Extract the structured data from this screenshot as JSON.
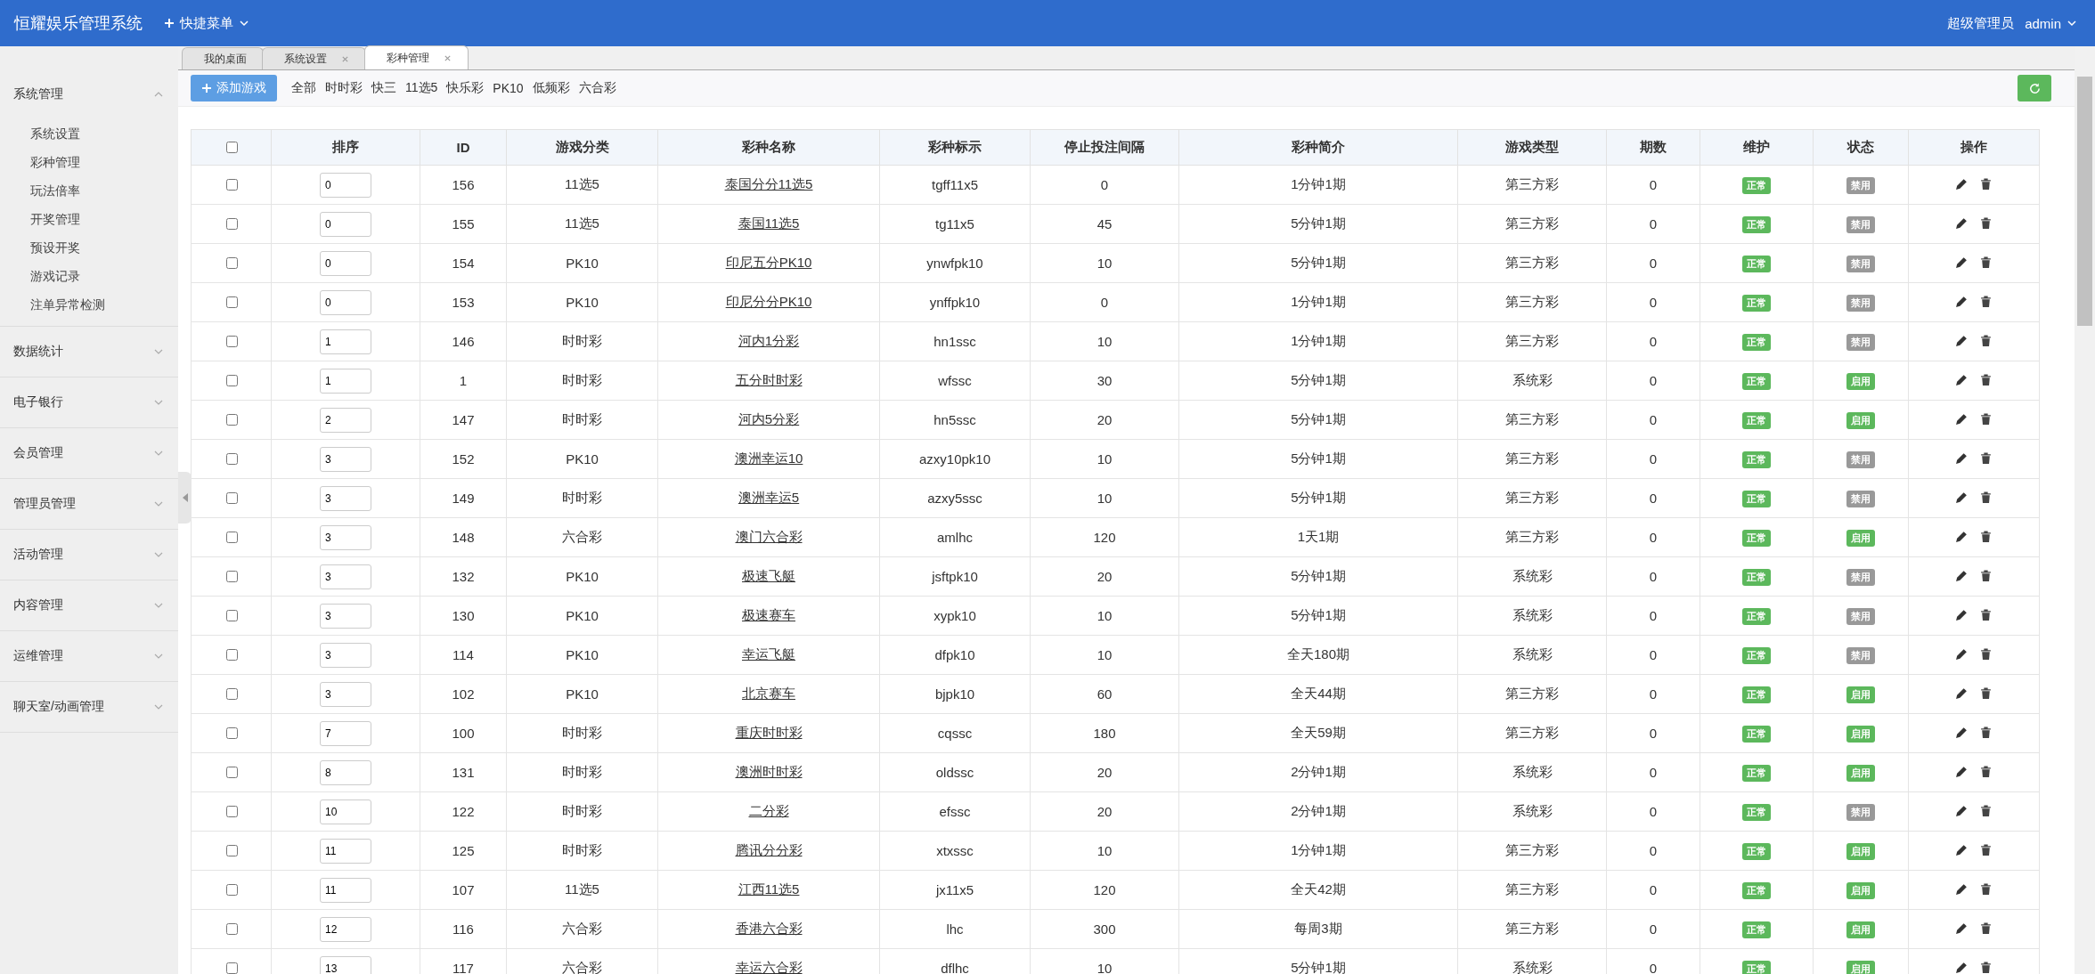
{
  "app": {
    "title": "恒耀娱乐管理系统",
    "quick_menu": "快捷菜单"
  },
  "user": {
    "role": "超级管理员",
    "name": "admin"
  },
  "sidebar": [
    {
      "label": "系统管理",
      "expanded": true,
      "children": [
        {
          "label": "系统设置"
        },
        {
          "label": "彩种管理"
        },
        {
          "label": "玩法倍率"
        },
        {
          "label": "开奖管理"
        },
        {
          "label": "预设开奖"
        },
        {
          "label": "游戏记录"
        },
        {
          "label": "注单异常检测"
        }
      ]
    },
    {
      "label": "数据统计",
      "expanded": false
    },
    {
      "label": "电子银行",
      "expanded": false
    },
    {
      "label": "会员管理",
      "expanded": false
    },
    {
      "label": "管理员管理",
      "expanded": false
    },
    {
      "label": "活动管理",
      "expanded": false
    },
    {
      "label": "内容管理",
      "expanded": false
    },
    {
      "label": "运维管理",
      "expanded": false
    },
    {
      "label": "聊天室/动画管理",
      "expanded": false
    }
  ],
  "tabs": [
    {
      "label": "我的桌面",
      "selected": false,
      "closable": false
    },
    {
      "label": "系统设置",
      "selected": false,
      "closable": true
    },
    {
      "label": "彩种管理",
      "selected": true,
      "closable": true
    }
  ],
  "toolbar": {
    "add_button": "添加游戏",
    "filters": [
      "全部",
      "时时彩",
      "快三",
      "11选5",
      "快乐彩",
      "PK10",
      "低频彩",
      "六合彩"
    ]
  },
  "table": {
    "all_checked": false,
    "columns": [
      "排序",
      "ID",
      "游戏分类",
      "彩种名称",
      "彩种标示",
      "停止投注间隔",
      "彩种简介",
      "游戏类型",
      "期数",
      "维护",
      "状态",
      "操作"
    ],
    "rows": [
      {
        "checked": false,
        "sort": "0",
        "id": "156",
        "category": "11选5",
        "name": "泰国分分11选5",
        "code": "tgff11x5",
        "stop_interval": "0",
        "intro": "1分钟1期",
        "type": "第三方彩",
        "periods": "0",
        "maintenance": "正常",
        "status": "禁用",
        "enabled": false
      },
      {
        "checked": false,
        "sort": "0",
        "id": "155",
        "category": "11选5",
        "name": "泰国11选5",
        "code": "tg11x5",
        "stop_interval": "45",
        "intro": "5分钟1期",
        "type": "第三方彩",
        "periods": "0",
        "maintenance": "正常",
        "status": "禁用",
        "enabled": false
      },
      {
        "checked": false,
        "sort": "0",
        "id": "154",
        "category": "PK10",
        "name": "印尼五分PK10",
        "code": "ynwfpk10",
        "stop_interval": "10",
        "intro": "5分钟1期",
        "type": "第三方彩",
        "periods": "0",
        "maintenance": "正常",
        "status": "禁用",
        "enabled": false
      },
      {
        "checked": false,
        "sort": "0",
        "id": "153",
        "category": "PK10",
        "name": "印尼分分PK10",
        "code": "ynffpk10",
        "stop_interval": "0",
        "intro": "1分钟1期",
        "type": "第三方彩",
        "periods": "0",
        "maintenance": "正常",
        "status": "禁用",
        "enabled": false
      },
      {
        "checked": false,
        "sort": "1",
        "id": "146",
        "category": "时时彩",
        "name": "河内1分彩",
        "code": "hn1ssc",
        "stop_interval": "10",
        "intro": "1分钟1期",
        "type": "第三方彩",
        "periods": "0",
        "maintenance": "正常",
        "status": "禁用",
        "enabled": false
      },
      {
        "checked": false,
        "sort": "1",
        "id": "1",
        "category": "时时彩",
        "name": "五分时时彩",
        "code": "wfssc",
        "stop_interval": "30",
        "intro": "5分钟1期",
        "type": "系统彩",
        "periods": "0",
        "maintenance": "正常",
        "status": "启用",
        "enabled": true
      },
      {
        "checked": false,
        "sort": "2",
        "id": "147",
        "category": "时时彩",
        "name": "河内5分彩",
        "code": "hn5ssc",
        "stop_interval": "20",
        "intro": "5分钟1期",
        "type": "第三方彩",
        "periods": "0",
        "maintenance": "正常",
        "status": "启用",
        "enabled": true
      },
      {
        "checked": false,
        "sort": "3",
        "id": "152",
        "category": "PK10",
        "name": "澳洲幸运10",
        "code": "azxy10pk10",
        "stop_interval": "10",
        "intro": "5分钟1期",
        "type": "第三方彩",
        "periods": "0",
        "maintenance": "正常",
        "status": "禁用",
        "enabled": false
      },
      {
        "checked": false,
        "sort": "3",
        "id": "149",
        "category": "时时彩",
        "name": "澳洲幸运5",
        "code": "azxy5ssc",
        "stop_interval": "10",
        "intro": "5分钟1期",
        "type": "第三方彩",
        "periods": "0",
        "maintenance": "正常",
        "status": "禁用",
        "enabled": false
      },
      {
        "checked": false,
        "sort": "3",
        "id": "148",
        "category": "六合彩",
        "name": "澳门六合彩",
        "code": "amlhc",
        "stop_interval": "120",
        "intro": "1天1期",
        "type": "第三方彩",
        "periods": "0",
        "maintenance": "正常",
        "status": "启用",
        "enabled": true
      },
      {
        "checked": false,
        "sort": "3",
        "id": "132",
        "category": "PK10",
        "name": "极速飞艇",
        "code": "jsftpk10",
        "stop_interval": "20",
        "intro": "5分钟1期",
        "type": "系统彩",
        "periods": "0",
        "maintenance": "正常",
        "status": "禁用",
        "enabled": false
      },
      {
        "checked": false,
        "sort": "3",
        "id": "130",
        "category": "PK10",
        "name": "极速赛车",
        "code": "xypk10",
        "stop_interval": "10",
        "intro": "5分钟1期",
        "type": "系统彩",
        "periods": "0",
        "maintenance": "正常",
        "status": "禁用",
        "enabled": false
      },
      {
        "checked": false,
        "sort": "3",
        "id": "114",
        "category": "PK10",
        "name": "幸运飞艇",
        "code": "dfpk10",
        "stop_interval": "10",
        "intro": "全天180期",
        "type": "系统彩",
        "periods": "0",
        "maintenance": "正常",
        "status": "禁用",
        "enabled": false
      },
      {
        "checked": false,
        "sort": "3",
        "id": "102",
        "category": "PK10",
        "name": "北京赛车",
        "code": "bjpk10",
        "stop_interval": "60",
        "intro": "全天44期",
        "type": "第三方彩",
        "periods": "0",
        "maintenance": "正常",
        "status": "启用",
        "enabled": true
      },
      {
        "checked": false,
        "sort": "7",
        "id": "100",
        "category": "时时彩",
        "name": "重庆时时彩",
        "code": "cqssc",
        "stop_interval": "180",
        "intro": "全天59期",
        "type": "第三方彩",
        "periods": "0",
        "maintenance": "正常",
        "status": "启用",
        "enabled": true
      },
      {
        "checked": false,
        "sort": "8",
        "id": "131",
        "category": "时时彩",
        "name": "澳洲时时彩",
        "code": "oldssc",
        "stop_interval": "20",
        "intro": "2分钟1期",
        "type": "系统彩",
        "periods": "0",
        "maintenance": "正常",
        "status": "启用",
        "enabled": true
      },
      {
        "checked": false,
        "sort": "10",
        "id": "122",
        "category": "时时彩",
        "name": "二分彩",
        "code": "efssc",
        "stop_interval": "20",
        "intro": "2分钟1期",
        "type": "系统彩",
        "periods": "0",
        "maintenance": "正常",
        "status": "禁用",
        "enabled": false
      },
      {
        "checked": false,
        "sort": "11",
        "id": "125",
        "category": "时时彩",
        "name": "腾讯分分彩",
        "code": "xtxssc",
        "stop_interval": "10",
        "intro": "1分钟1期",
        "type": "第三方彩",
        "periods": "0",
        "maintenance": "正常",
        "status": "启用",
        "enabled": true
      },
      {
        "checked": false,
        "sort": "11",
        "id": "107",
        "category": "11选5",
        "name": "江西11选5",
        "code": "jx11x5",
        "stop_interval": "120",
        "intro": "全天42期",
        "type": "第三方彩",
        "periods": "0",
        "maintenance": "正常",
        "status": "启用",
        "enabled": true
      },
      {
        "checked": false,
        "sort": "12",
        "id": "116",
        "category": "六合彩",
        "name": "香港六合彩",
        "code": "lhc",
        "stop_interval": "300",
        "intro": "每周3期",
        "type": "第三方彩",
        "periods": "0",
        "maintenance": "正常",
        "status": "启用",
        "enabled": true
      },
      {
        "checked": false,
        "sort": "13",
        "id": "117",
        "category": "六合彩",
        "name": "幸运六合彩",
        "code": "dflhc",
        "stop_interval": "10",
        "intro": "5分钟1期",
        "type": "系统彩",
        "periods": "0",
        "maintenance": "正常",
        "status": "启用",
        "enabled": true
      }
    ]
  }
}
